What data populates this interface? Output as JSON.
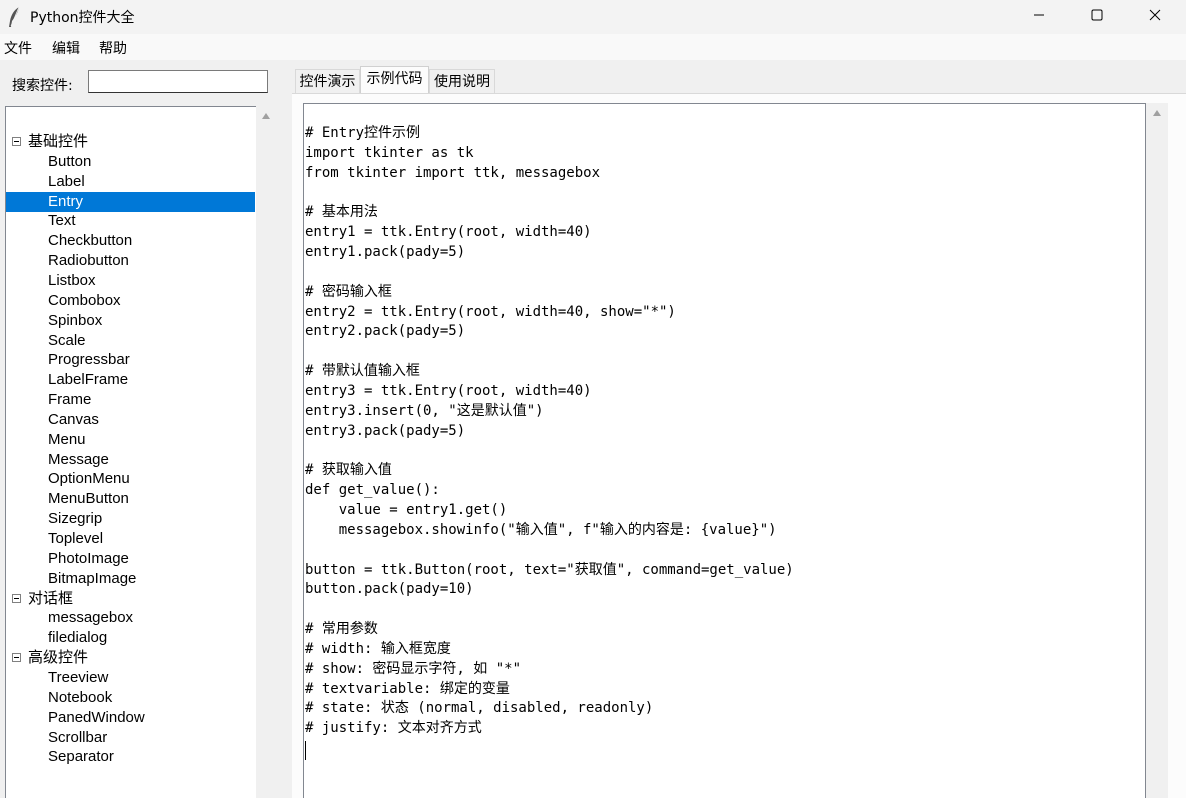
{
  "window": {
    "title": "Python控件大全",
    "app_icon": "feather-icon",
    "controls": [
      "minimize-icon",
      "maximize-icon",
      "close-icon"
    ]
  },
  "menu": {
    "items": [
      "文件",
      "编辑",
      "帮助"
    ]
  },
  "search": {
    "label": "搜索控件:",
    "value": "",
    "placeholder": ""
  },
  "tree": {
    "selected": "Entry",
    "categories": [
      {
        "label": "基础控件",
        "expanded": true,
        "items": [
          "Button",
          "Label",
          "Entry",
          "Text",
          "Checkbutton",
          "Radiobutton",
          "Listbox",
          "Combobox",
          "Spinbox",
          "Scale",
          "Progressbar",
          "LabelFrame",
          "Frame",
          "Canvas",
          "Menu",
          "Message",
          "OptionMenu",
          "MenuButton",
          "Sizegrip",
          "Toplevel",
          "PhotoImage",
          "BitmapImage"
        ]
      },
      {
        "label": "对话框",
        "expanded": true,
        "items": [
          "messagebox",
          "filedialog"
        ]
      },
      {
        "label": "高级控件",
        "expanded": true,
        "items": [
          "Treeview",
          "Notebook",
          "PanedWindow",
          "Scrollbar",
          "Separator"
        ]
      }
    ]
  },
  "tabs": [
    {
      "label": "控件演示",
      "active": false
    },
    {
      "label": "示例代码",
      "active": true
    },
    {
      "label": "使用说明",
      "active": false
    }
  ],
  "code": {
    "lines": [
      "# Entry控件示例",
      "import tkinter as tk",
      "from tkinter import ttk, messagebox",
      "",
      "# 基本用法",
      "entry1 = ttk.Entry(root, width=40)",
      "entry1.pack(pady=5)",
      "",
      "# 密码输入框",
      "entry2 = ttk.Entry(root, width=40, show=\"*\")",
      "entry2.pack(pady=5)",
      "",
      "# 带默认值输入框",
      "entry3 = ttk.Entry(root, width=40)",
      "entry3.insert(0, \"这是默认值\")",
      "entry3.pack(pady=5)",
      "",
      "# 获取输入值",
      "def get_value():",
      "    value = entry1.get()",
      "    messagebox.showinfo(\"输入值\", f\"输入的内容是: {value}\")",
      "",
      "button = ttk.Button(root, text=\"获取值\", command=get_value)",
      "button.pack(pady=10)",
      "",
      "# 常用参数",
      "# width: 输入框宽度",
      "# show: 密码显示字符, 如 \"*\"",
      "# textvariable: 绑定的变量",
      "# state: 状态 (normal, disabled, readonly)",
      "# justify: 文本对齐方式"
    ]
  },
  "colors": {
    "selection": "#0078d7",
    "window_bg": "#f0f0f0"
  }
}
